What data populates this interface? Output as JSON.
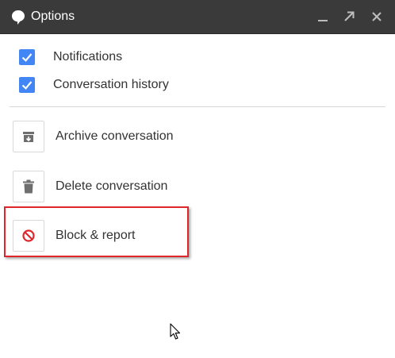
{
  "window": {
    "title": "Options",
    "controls": {
      "minimize_icon": "minimize-icon",
      "popout_icon": "popout-icon",
      "close_icon": "close-icon"
    }
  },
  "options": [
    {
      "label": "Notifications",
      "checked": true
    },
    {
      "label": "Conversation history",
      "checked": true
    }
  ],
  "actions": [
    {
      "label": "Archive conversation",
      "icon": "archive-icon"
    },
    {
      "label": "Delete conversation",
      "icon": "trash-icon"
    },
    {
      "label": "Block & report",
      "icon": "block-icon"
    }
  ],
  "colors": {
    "titlebar": "#3a3a3a",
    "checkbox": "#4285f4",
    "highlight": "#e0262b",
    "block_icon": "#e0262b"
  }
}
